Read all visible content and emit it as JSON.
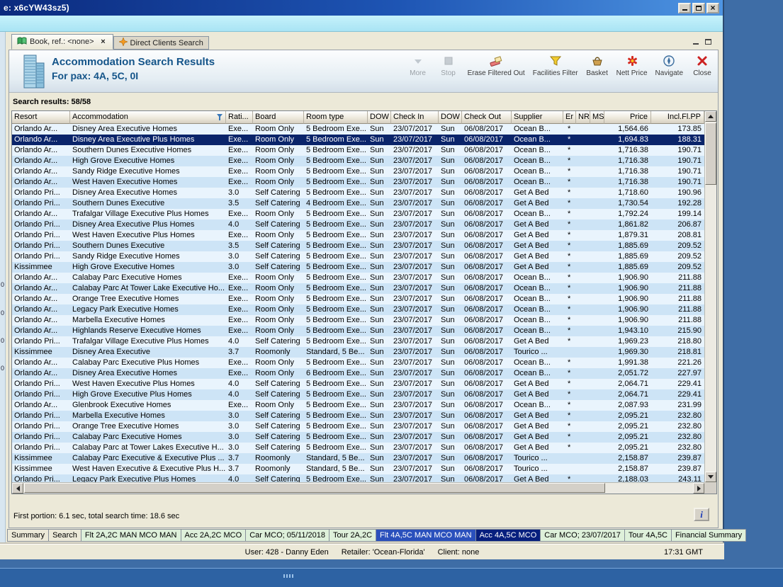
{
  "window": {
    "title": "e: x6cYW43sz5)"
  },
  "doc_tabs": [
    {
      "label": "Book, ref.: <none>",
      "active": true
    },
    {
      "label": "Direct Clients Search",
      "active": false
    }
  ],
  "header": {
    "line1": "Accommodation Search Results",
    "line2": "For pax: 4A, 5C, 0I"
  },
  "toolbar": [
    {
      "label": "More",
      "disabled": true
    },
    {
      "label": "Stop",
      "disabled": true
    },
    {
      "label": "Erase Filtered Out",
      "disabled": false
    },
    {
      "label": "Facilities Filter",
      "disabled": false
    },
    {
      "label": "Basket",
      "disabled": false
    },
    {
      "label": "Nett Price",
      "disabled": false
    },
    {
      "label": "Navigate",
      "disabled": false
    },
    {
      "label": "Close",
      "disabled": false
    }
  ],
  "results_label": "Search results: 58/58",
  "table": {
    "columns": [
      "Resort",
      "Accommodation",
      "Rati...",
      "Board",
      "Room type",
      "DOW",
      "Check In",
      "DOW",
      "Check Out",
      "Supplier",
      "Er",
      "NR",
      "MS",
      "Price",
      "Incl.Fl.PP"
    ],
    "filter_column": 1,
    "selected_index": 1,
    "rows": [
      [
        "Orlando Ar...",
        "Disney Area Executive Homes",
        "Exe...",
        "Room Only",
        "5 Bedroom Exe...",
        "Sun",
        "23/07/2017",
        "Sun",
        "06/08/2017",
        "Ocean B...",
        "*",
        "",
        "",
        "1,564.66",
        "173.85"
      ],
      [
        "Orlando Ar...",
        "Disney Area Executive Plus Homes",
        "Exe...",
        "Room Only",
        "5 Bedroom Exe...",
        "Sun",
        "23/07/2017",
        "Sun",
        "06/08/2017",
        "Ocean B...",
        "*",
        "",
        "",
        "1,694.83",
        "188.31"
      ],
      [
        "Orlando Ar...",
        "Southern Dunes Executive Homes",
        "Exe...",
        "Room Only",
        "5 Bedroom Exe...",
        "Sun",
        "23/07/2017",
        "Sun",
        "06/08/2017",
        "Ocean B...",
        "*",
        "",
        "",
        "1,716.38",
        "190.71"
      ],
      [
        "Orlando Ar...",
        "High Grove Executive Homes",
        "Exe...",
        "Room Only",
        "5 Bedroom Exe...",
        "Sun",
        "23/07/2017",
        "Sun",
        "06/08/2017",
        "Ocean B...",
        "*",
        "",
        "",
        "1,716.38",
        "190.71"
      ],
      [
        "Orlando Ar...",
        "Sandy Ridge Executive Homes",
        "Exe...",
        "Room Only",
        "5 Bedroom Exe...",
        "Sun",
        "23/07/2017",
        "Sun",
        "06/08/2017",
        "Ocean B...",
        "*",
        "",
        "",
        "1,716.38",
        "190.71"
      ],
      [
        "Orlando Ar...",
        "West Haven Executive Homes",
        "Exe...",
        "Room Only",
        "5 Bedroom Exe...",
        "Sun",
        "23/07/2017",
        "Sun",
        "06/08/2017",
        "Ocean B...",
        "*",
        "",
        "",
        "1,716.38",
        "190.71"
      ],
      [
        "Orlando Pri...",
        "Disney Area Executive Homes",
        "3.0",
        "Self Catering",
        "5 Bedroom Exe...",
        "Sun",
        "23/07/2017",
        "Sun",
        "06/08/2017",
        "Get A Bed",
        "*",
        "",
        "",
        "1,718.60",
        "190.96"
      ],
      [
        "Orlando Pri...",
        "Southern Dunes Executive",
        "3.5",
        "Self Catering",
        "4 Bedroom Exe...",
        "Sun",
        "23/07/2017",
        "Sun",
        "06/08/2017",
        "Get A Bed",
        "*",
        "",
        "",
        "1,730.54",
        "192.28"
      ],
      [
        "Orlando Ar...",
        "Trafalgar Village Executive Plus Homes",
        "Exe...",
        "Room Only",
        "5 Bedroom Exe...",
        "Sun",
        "23/07/2017",
        "Sun",
        "06/08/2017",
        "Ocean B...",
        "*",
        "",
        "",
        "1,792.24",
        "199.14"
      ],
      [
        "Orlando Pri...",
        "Disney Area Executive Plus Homes",
        "4.0",
        "Self Catering",
        "5 Bedroom Exe...",
        "Sun",
        "23/07/2017",
        "Sun",
        "06/08/2017",
        "Get A Bed",
        "*",
        "",
        "",
        "1,861.82",
        "206.87"
      ],
      [
        "Orlando Pri...",
        "West Haven Executive Plus Homes",
        "Exe...",
        "Room Only",
        "5 Bedroom Exe...",
        "Sun",
        "23/07/2017",
        "Sun",
        "06/08/2017",
        "Get A Bed",
        "*",
        "",
        "",
        "1,879.31",
        "208.81"
      ],
      [
        "Orlando Pri...",
        "Southern Dunes Executive",
        "3.5",
        "Self Catering",
        "5 Bedroom Exe...",
        "Sun",
        "23/07/2017",
        "Sun",
        "06/08/2017",
        "Get A Bed",
        "*",
        "",
        "",
        "1,885.69",
        "209.52"
      ],
      [
        "Orlando Pri...",
        "Sandy Ridge Executive Homes",
        "3.0",
        "Self Catering",
        "5 Bedroom Exe...",
        "Sun",
        "23/07/2017",
        "Sun",
        "06/08/2017",
        "Get A Bed",
        "*",
        "",
        "",
        "1,885.69",
        "209.52"
      ],
      [
        "Kissimmee",
        "High Grove Executive Homes",
        "3.0",
        "Self Catering",
        "5 Bedroom Exe...",
        "Sun",
        "23/07/2017",
        "Sun",
        "06/08/2017",
        "Get A Bed",
        "*",
        "",
        "",
        "1,885.69",
        "209.52"
      ],
      [
        "Orlando Ar...",
        "Calabay Parc Executive Homes",
        "Exe...",
        "Room Only",
        "5 Bedroom Exe...",
        "Sun",
        "23/07/2017",
        "Sun",
        "06/08/2017",
        "Ocean B...",
        "*",
        "",
        "",
        "1,906.90",
        "211.88"
      ],
      [
        "Orlando Ar...",
        "Calabay Parc At Tower Lake Executive Ho...",
        "Exe...",
        "Room Only",
        "5 Bedroom Exe...",
        "Sun",
        "23/07/2017",
        "Sun",
        "06/08/2017",
        "Ocean B...",
        "*",
        "",
        "",
        "1,906.90",
        "211.88"
      ],
      [
        "Orlando Ar...",
        "Orange Tree Executive Homes",
        "Exe...",
        "Room Only",
        "5 Bedroom Exe...",
        "Sun",
        "23/07/2017",
        "Sun",
        "06/08/2017",
        "Ocean B...",
        "*",
        "",
        "",
        "1,906.90",
        "211.88"
      ],
      [
        "Orlando Ar...",
        "Legacy Park Executive Homes",
        "Exe...",
        "Room Only",
        "5 Bedroom Exe...",
        "Sun",
        "23/07/2017",
        "Sun",
        "06/08/2017",
        "Ocean B...",
        "*",
        "",
        "",
        "1,906.90",
        "211.88"
      ],
      [
        "Orlando Ar...",
        "Marbella Executive Homes",
        "Exe...",
        "Room Only",
        "5 Bedroom Exe...",
        "Sun",
        "23/07/2017",
        "Sun",
        "06/08/2017",
        "Ocean B...",
        "*",
        "",
        "",
        "1,906.90",
        "211.88"
      ],
      [
        "Orlando Ar...",
        "Highlands Reserve Executive Homes",
        "Exe...",
        "Room Only",
        "5 Bedroom Exe...",
        "Sun",
        "23/07/2017",
        "Sun",
        "06/08/2017",
        "Ocean B...",
        "*",
        "",
        "",
        "1,943.10",
        "215.90"
      ],
      [
        "Orlando Pri...",
        "Trafalgar Village Executive Plus Homes",
        "4.0",
        "Self Catering",
        "5 Bedroom Exe...",
        "Sun",
        "23/07/2017",
        "Sun",
        "06/08/2017",
        "Get A Bed",
        "*",
        "",
        "",
        "1,969.23",
        "218.80"
      ],
      [
        "Kissimmee",
        "Disney Area Executive",
        "3.7",
        "Roomonly",
        "Standard, 5 Be...",
        "Sun",
        "23/07/2017",
        "Sun",
        "06/08/2017",
        "Tourico ...",
        "",
        "",
        "",
        "1,969.30",
        "218.81"
      ],
      [
        "Orlando Ar...",
        "Calabay Parc Executive Plus Homes",
        "Exe...",
        "Room Only",
        "5 Bedroom Exe...",
        "Sun",
        "23/07/2017",
        "Sun",
        "06/08/2017",
        "Ocean B...",
        "*",
        "",
        "",
        "1,991.38",
        "221.26"
      ],
      [
        "Orlando Ar...",
        "Disney Area Executive Homes",
        "Exe...",
        "Room Only",
        "6 Bedroom Exe...",
        "Sun",
        "23/07/2017",
        "Sun",
        "06/08/2017",
        "Ocean B...",
        "*",
        "",
        "",
        "2,051.72",
        "227.97"
      ],
      [
        "Orlando Pri...",
        "West Haven Executive Plus Homes",
        "4.0",
        "Self Catering",
        "5 Bedroom Exe...",
        "Sun",
        "23/07/2017",
        "Sun",
        "06/08/2017",
        "Get A Bed",
        "*",
        "",
        "",
        "2,064.71",
        "229.41"
      ],
      [
        "Orlando Pri...",
        "High Grove Executive Plus Homes",
        "4.0",
        "Self Catering",
        "5 Bedroom Exe...",
        "Sun",
        "23/07/2017",
        "Sun",
        "06/08/2017",
        "Get A Bed",
        "*",
        "",
        "",
        "2,064.71",
        "229.41"
      ],
      [
        "Orlando Ar...",
        "Glenbrook Executive Homes",
        "Exe...",
        "Room Only",
        "5 Bedroom Exe...",
        "Sun",
        "23/07/2017",
        "Sun",
        "06/08/2017",
        "Ocean B...",
        "*",
        "",
        "",
        "2,087.93",
        "231.99"
      ],
      [
        "Orlando Pri...",
        "Marbella Executive Homes",
        "3.0",
        "Self Catering",
        "5 Bedroom Exe...",
        "Sun",
        "23/07/2017",
        "Sun",
        "06/08/2017",
        "Get A Bed",
        "*",
        "",
        "",
        "2,095.21",
        "232.80"
      ],
      [
        "Orlando Pri...",
        "Orange Tree Executive Homes",
        "3.0",
        "Self Catering",
        "5 Bedroom Exe...",
        "Sun",
        "23/07/2017",
        "Sun",
        "06/08/2017",
        "Get A Bed",
        "*",
        "",
        "",
        "2,095.21",
        "232.80"
      ],
      [
        "Orlando Pri...",
        "Calabay Parc Executive Homes",
        "3.0",
        "Self Catering",
        "5 Bedroom Exe...",
        "Sun",
        "23/07/2017",
        "Sun",
        "06/08/2017",
        "Get A Bed",
        "*",
        "",
        "",
        "2,095.21",
        "232.80"
      ],
      [
        "Orlando Pri...",
        "Calabay Parc at Tower Lakes Executive H...",
        "3.0",
        "Self Catering",
        "5 Bedroom Exe...",
        "Sun",
        "23/07/2017",
        "Sun",
        "06/08/2017",
        "Get A Bed",
        "*",
        "",
        "",
        "2,095.21",
        "232.80"
      ],
      [
        "Kissimmee",
        "Calabay Parc Executive & Executive Plus ...",
        "3.7",
        "Roomonly",
        "Standard, 5 Be...",
        "Sun",
        "23/07/2017",
        "Sun",
        "06/08/2017",
        "Tourico ...",
        "",
        "",
        "",
        "2,158.87",
        "239.87"
      ],
      [
        "Kissimmee",
        "West Haven Executive & Executive Plus H...",
        "3.7",
        "Roomonly",
        "Standard, 5 Be...",
        "Sun",
        "23/07/2017",
        "Sun",
        "06/08/2017",
        "Tourico ...",
        "",
        "",
        "",
        "2,158.87",
        "239.87"
      ],
      [
        "Orlando Pri...",
        "Legacy Park Executive Plus Homes",
        "4.0",
        "Self Catering",
        "5 Bedroom Exe...",
        "Sun",
        "23/07/2017",
        "Sun",
        "06/08/2017",
        "Get A Bed",
        "*",
        "",
        "",
        "2,188.03",
        "243.11"
      ]
    ]
  },
  "footer": {
    "timing": "First portion: 6.1 sec, total search time: 18.6 sec",
    "info_button": "i"
  },
  "bottom_tabs": [
    {
      "label": "Summary",
      "style": "gray"
    },
    {
      "label": "Search",
      "style": "gray"
    },
    {
      "label": "Flt 2A,2C MAN MCO MAN",
      "style": "green"
    },
    {
      "label": "Acc 2A,2C MCO",
      "style": "green"
    },
    {
      "label": "Car MCO; 05/11/2018",
      "style": "green"
    },
    {
      "label": "Tour 2A,2C",
      "style": "green"
    },
    {
      "label": "Flt 4A,5C MAN MCO MAN",
      "style": "blue"
    },
    {
      "label": "Acc 4A,5C MCO",
      "style": "navy"
    },
    {
      "label": "Car MCO; 23/07/2017",
      "style": "green"
    },
    {
      "label": "Tour 4A,5C",
      "style": "green"
    },
    {
      "label": "Financial Summary",
      "style": "green"
    }
  ],
  "statusbar": {
    "user": "User: 428 - Danny Eden",
    "retailer": "Retailer: 'Ocean-Florida'",
    "client": "Client: none",
    "time": "17:31 GMT"
  },
  "left_edge_digits": [
    "0",
    "0",
    "0",
    "0"
  ]
}
